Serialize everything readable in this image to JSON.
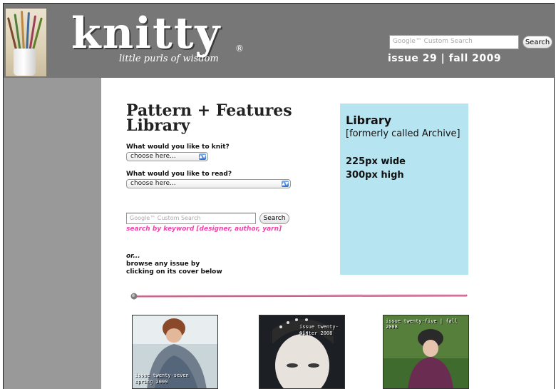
{
  "header": {
    "logo": "knitty",
    "tagline": "little purls of wisdom",
    "search_placeholder": "Google™ Custom Search",
    "search_button": "Search",
    "issue_line": "issue 29 | fall 2009"
  },
  "main": {
    "title": "Pattern + Features Library",
    "knit_label": "What would you like to knit?",
    "knit_select": "choose here...",
    "read_label": "What would you like to read?",
    "read_select": "choose here...",
    "search_placeholder": "Google™ Custom Search",
    "search_button": "Search",
    "search_hint": "search by keyword [designer, author, yarn]",
    "or_text": "or...",
    "browse_line1": "browse any issue by",
    "browse_line2": "clicking on its cover below"
  },
  "ad": {
    "title": "Library",
    "subtitle": "[formerly called Archive]",
    "width": "225px wide",
    "height": "300px high"
  },
  "covers": [
    {
      "label_line1": "issue twenty-seven",
      "label_line2": "spring 2009"
    },
    {
      "label_line1": "issue twenty-six",
      "label_line2": "winter 2008"
    },
    {
      "label_line1": "issue twenty-five | fall 2008"
    }
  ],
  "colors": {
    "header_bg": "#777777",
    "sidebar_bg": "#999999",
    "ad_bg": "#b6e4f1",
    "hint_pink": "#ee46a8"
  }
}
